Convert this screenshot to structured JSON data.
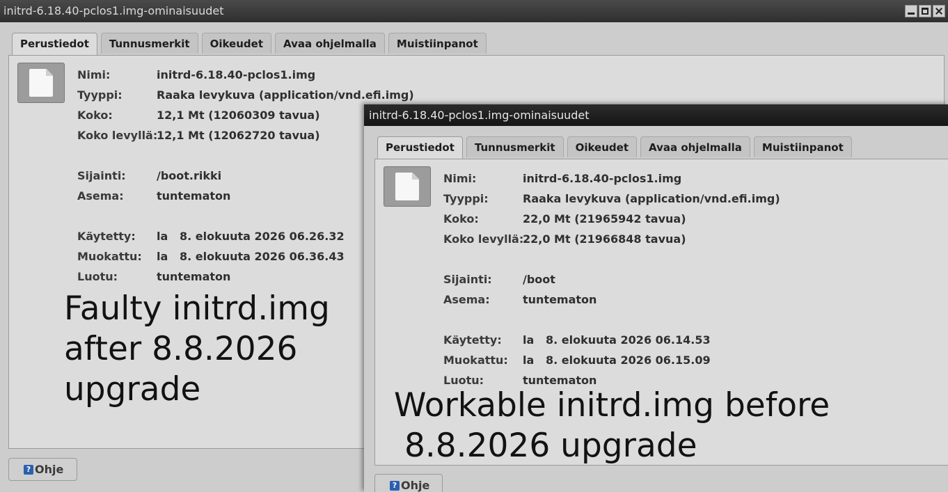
{
  "windows": [
    {
      "title": "initrd-6.18.40-pclos1.img-ominaisuudet",
      "tabs": [
        "Perustiedot",
        "Tunnusmerkit",
        "Oikeudet",
        "Avaa ohjelmalla",
        "Muistiinpanot"
      ],
      "properties": [
        {
          "label": "Nimi:",
          "value": "initrd-6.18.40-pclos1.img"
        },
        {
          "label": "Tyyppi:",
          "value": "Raaka levykuva (application/vnd.efi.img)"
        },
        {
          "label": "Koko:",
          "value": "12,1 Mt (12060309 tavua)"
        },
        {
          "label": "Koko levyllä:",
          "value": "12,1 Mt (12062720 tavua)"
        },
        {
          "label": "Sijainti:",
          "value": "/boot.rikki"
        },
        {
          "label": "Asema:",
          "value": "tuntematon"
        },
        {
          "label": "Käytetty:",
          "value": "la   8. elokuuta 2026 06.26.32"
        },
        {
          "label": "Muokattu:",
          "value": "la   8. elokuuta 2026 06.36.43"
        },
        {
          "label": "Luotu:",
          "value": "tuntematon"
        }
      ],
      "annotation": "Faulty initrd.img\nafter 8.8.2026\nupgrade",
      "help_label": "Ohje"
    },
    {
      "title": "initrd-6.18.40-pclos1.img-ominaisuudet",
      "tabs": [
        "Perustiedot",
        "Tunnusmerkit",
        "Oikeudet",
        "Avaa ohjelmalla",
        "Muistiinpanot"
      ],
      "properties": [
        {
          "label": "Nimi:",
          "value": "initrd-6.18.40-pclos1.img"
        },
        {
          "label": "Tyyppi:",
          "value": "Raaka levykuva (application/vnd.efi.img)"
        },
        {
          "label": "Koko:",
          "value": "22,0 Mt (21965942 tavua)"
        },
        {
          "label": "Koko levyllä:",
          "value": "22,0 Mt (21966848 tavua)"
        },
        {
          "label": "Sijainti:",
          "value": "/boot"
        },
        {
          "label": "Asema:",
          "value": "tuntematon"
        },
        {
          "label": "Käytetty:",
          "value": "la   8. elokuuta 2026 06.14.53"
        },
        {
          "label": "Muokattu:",
          "value": "la   8. elokuuta 2026 06.15.09"
        },
        {
          "label": "Luotu:",
          "value": "tuntematon"
        }
      ],
      "annotation": "Workable initrd.img before\n 8.8.2026 upgrade",
      "help_label": "Ohje"
    }
  ]
}
